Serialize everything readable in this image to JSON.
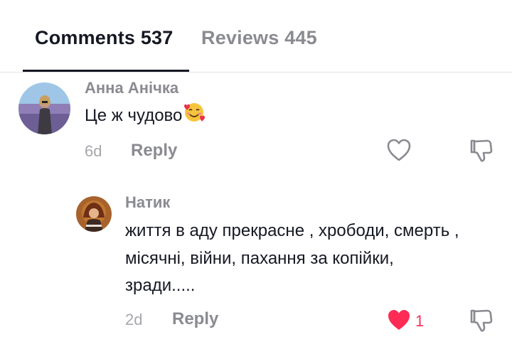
{
  "tabs": [
    {
      "label": "Comments 537",
      "active": true
    },
    {
      "label": "Reviews 445",
      "active": false
    }
  ],
  "comments": [
    {
      "author": "Анна Анічка",
      "text": "Це ж чудово",
      "emoji": "smiling-face-with-hearts-icon",
      "time": "6d",
      "reply_label": "Reply",
      "liked": false
    },
    {
      "author": "Натик",
      "text_lines": [
        "життя в аду прекрасне , хрободи, смерть ,",
        "місячні, війни, пахання за копійки,",
        "зради....."
      ],
      "time": "2d",
      "reply_label": "Reply",
      "liked": true,
      "like_count": "1"
    }
  ],
  "colors": {
    "text_primary": "#161823",
    "text_secondary": "#8a8b91",
    "like_red": "#fe2c55"
  }
}
